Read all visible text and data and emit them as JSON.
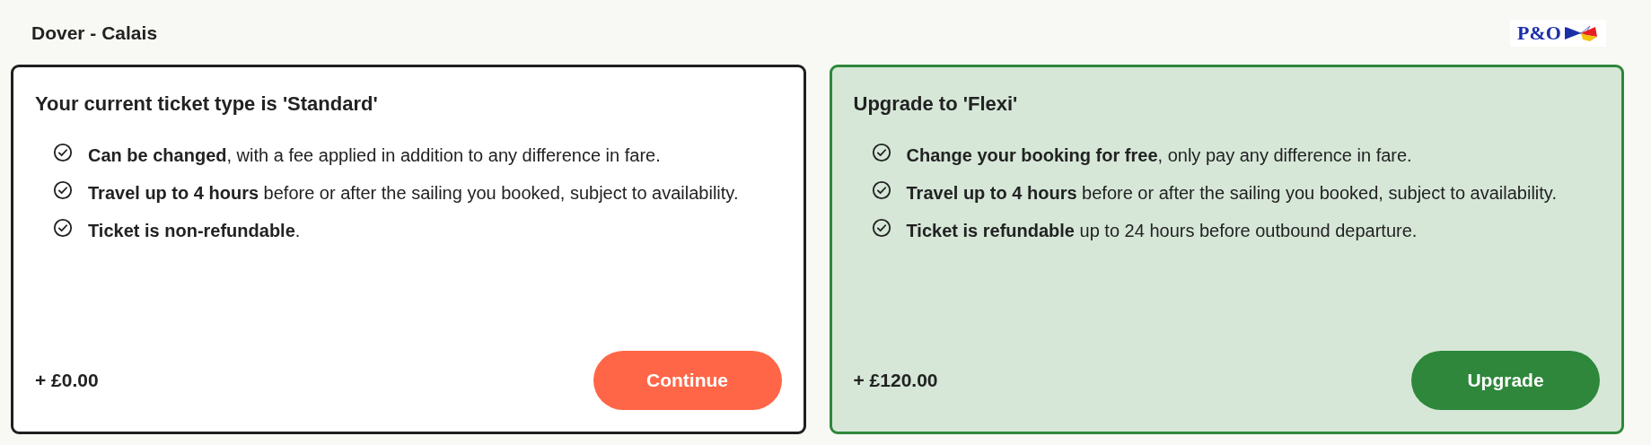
{
  "route": "Dover - Calais",
  "logo": {
    "text": "P&O"
  },
  "cards": [
    {
      "kind": "current",
      "title": "Your current ticket type is 'Standard'",
      "features": [
        "**Can be changed**, with a fee applied in addition to any difference in fare.",
        "**Travel up to 4 hours** before or after the sailing you booked, subject to availability.",
        "**Ticket is non-refundable**."
      ],
      "price": "+ £0.00",
      "button": "Continue"
    },
    {
      "kind": "upgrade",
      "title": "Upgrade to 'Flexi'",
      "features": [
        "**Change your booking for free**, only pay any difference in fare.",
        "**Travel up to 4 hours** before or after the sailing you booked, subject to availability.",
        "**Ticket is refundable** up to 24 hours before outbound departure."
      ],
      "price": "+ £120.00",
      "button": "Upgrade"
    }
  ]
}
